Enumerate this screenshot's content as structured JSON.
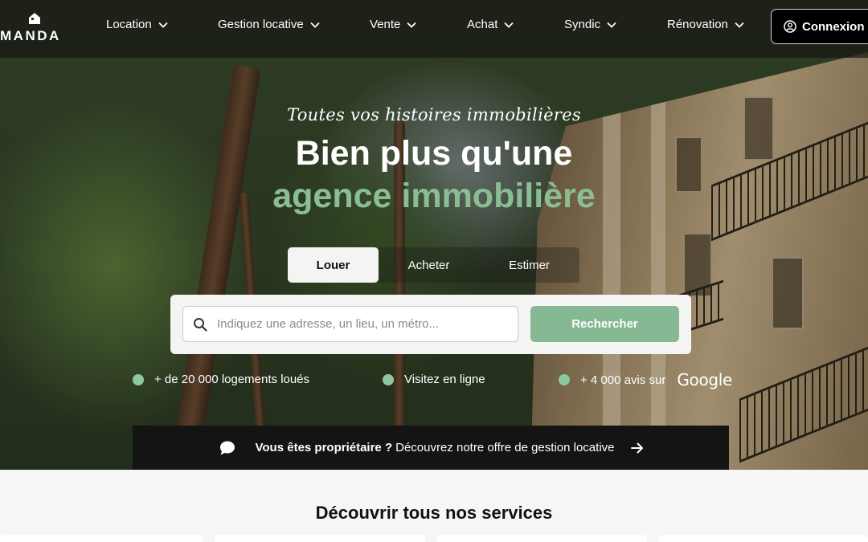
{
  "brand": {
    "name": "MANDA",
    "accent": "#86b894",
    "dark": "#141414"
  },
  "nav": {
    "items": [
      {
        "label": "Location"
      },
      {
        "label": "Gestion locative"
      },
      {
        "label": "Vente"
      },
      {
        "label": "Achat"
      },
      {
        "label": "Syndic"
      },
      {
        "label": "Rénovation"
      }
    ],
    "login_label": "Connexion",
    "login_icon": "user-circle-icon"
  },
  "hero": {
    "tagline": "Toutes vos histoires immobilières",
    "headline_line1": "Bien plus qu'une",
    "headline_line2": "agence immobilière",
    "tabs": [
      {
        "label": "Louer",
        "active": true
      },
      {
        "label": "Acheter",
        "active": false
      },
      {
        "label": "Estimer",
        "active": false
      }
    ],
    "search": {
      "placeholder": "Indiquez une adresse, un lieu, un métro...",
      "value": "",
      "button_label": "Rechercher",
      "icon": "search-icon"
    },
    "features": [
      {
        "text": "+ de 20 000 logements loués"
      },
      {
        "text": "Visitez en ligne"
      },
      {
        "text": "+ 4 000 avis sur",
        "logo_text": "Google"
      }
    ]
  },
  "owner_banner": {
    "bold": "Vous êtes propriétaire ?",
    "text": "Découvrez notre offre de gestion locative",
    "icon": "chat-bubble-icon",
    "arrow_icon": "arrow-right-icon"
  },
  "services": {
    "title": "Découvrir tous nos services"
  }
}
